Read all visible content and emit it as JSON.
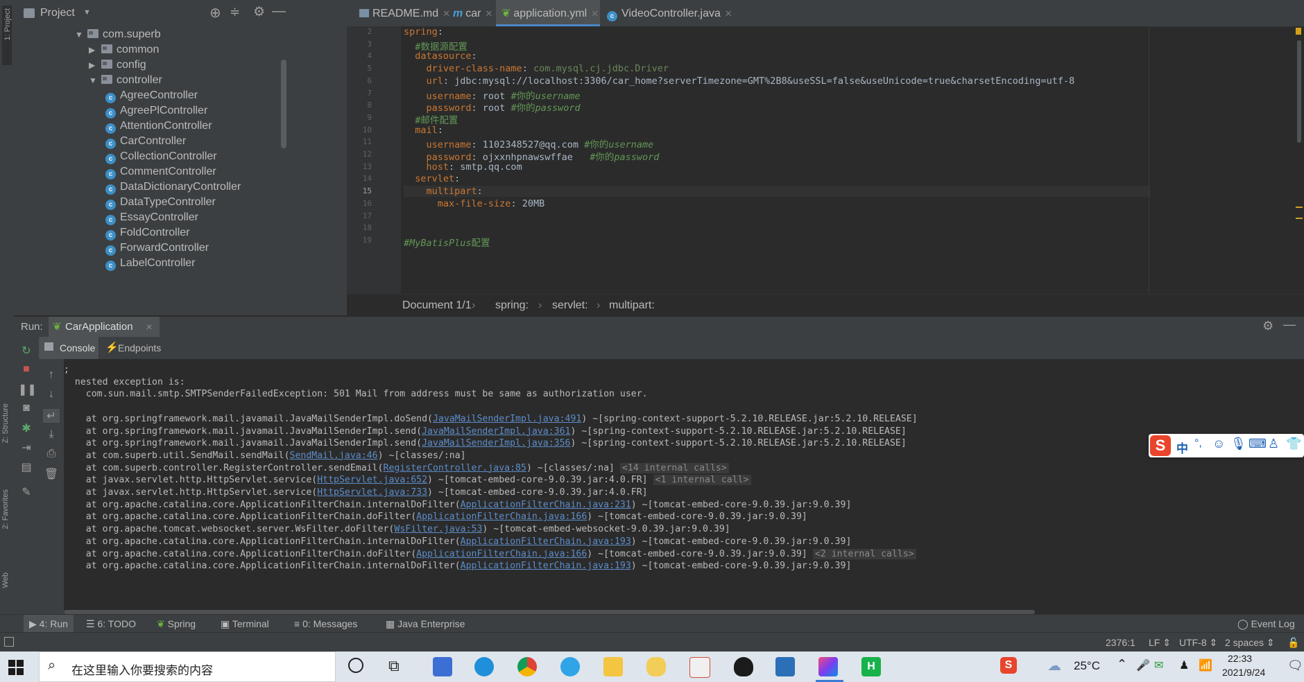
{
  "left_strip": {
    "project_label": "1: Project",
    "structure_label": "Z: Structure",
    "favorites_label": "2: Favorites",
    "web_label": "Web"
  },
  "project": {
    "title": "Project",
    "tree": [
      {
        "label": "com.superb",
        "kind": "package",
        "expanded": true,
        "level": 0
      },
      {
        "label": "common",
        "kind": "package",
        "expanded": false,
        "level": 1
      },
      {
        "label": "config",
        "kind": "package",
        "expanded": false,
        "level": 1
      },
      {
        "label": "controller",
        "kind": "package",
        "expanded": true,
        "level": 1
      },
      {
        "label": "AgreeController",
        "kind": "class",
        "level": 2
      },
      {
        "label": "AgreePlController",
        "kind": "class",
        "level": 2
      },
      {
        "label": "AttentionController",
        "kind": "class",
        "level": 2
      },
      {
        "label": "CarController",
        "kind": "class",
        "level": 2
      },
      {
        "label": "CollectionController",
        "kind": "class",
        "level": 2
      },
      {
        "label": "CommentController",
        "kind": "class",
        "level": 2
      },
      {
        "label": "DataDictionaryController",
        "kind": "class",
        "level": 2
      },
      {
        "label": "DataTypeController",
        "kind": "class",
        "level": 2
      },
      {
        "label": "EssayController",
        "kind": "class",
        "level": 2
      },
      {
        "label": "FoldController",
        "kind": "class",
        "level": 2
      },
      {
        "label": "ForwardController",
        "kind": "class",
        "level": 2
      },
      {
        "label": "LabelController",
        "kind": "class",
        "level": 2
      }
    ]
  },
  "tabs": [
    {
      "label": "README.md",
      "icon": "markdown-icon",
      "active": false
    },
    {
      "label": "car",
      "icon": "m-icon",
      "active": false
    },
    {
      "label": "application.yml",
      "icon": "spring-leaf-icon",
      "active": true
    },
    {
      "label": "VideoController.java",
      "icon": "class-icon",
      "active": false
    }
  ],
  "editor": {
    "lines": [
      {
        "n": "2",
        "parts": [
          {
            "t": "spring",
            "c": "k"
          },
          {
            "t": ":",
            "c": "v"
          }
        ]
      },
      {
        "n": "3",
        "parts": [
          {
            "t": "  #数据源配置",
            "c": "c"
          }
        ]
      },
      {
        "n": "4",
        "parts": [
          {
            "t": "  datasource",
            "c": "k"
          },
          {
            "t": ":",
            "c": "v"
          }
        ]
      },
      {
        "n": "5",
        "parts": [
          {
            "t": "    driver-class-name",
            "c": "k"
          },
          {
            "t": ": ",
            "c": "v"
          },
          {
            "t": "com.mysql.cj.jdbc.Driver",
            "c": "s"
          }
        ]
      },
      {
        "n": "6",
        "parts": [
          {
            "t": "    url",
            "c": "k"
          },
          {
            "t": ": jdbc:mysql://localhost:3306/car_home?serverTimezone=GMT%2B8&useSSL=false&useUnicode=true&charsetEncoding=utf-8",
            "c": "v"
          }
        ]
      },
      {
        "n": "7",
        "parts": [
          {
            "t": "    username",
            "c": "k"
          },
          {
            "t": ": root ",
            "c": "v"
          },
          {
            "t": "#你的",
            "c": "c"
          },
          {
            "t": "username",
            "c": "ci"
          }
        ]
      },
      {
        "n": "8",
        "parts": [
          {
            "t": "    password",
            "c": "k"
          },
          {
            "t": ": root ",
            "c": "v"
          },
          {
            "t": "#你的",
            "c": "c"
          },
          {
            "t": "password",
            "c": "ci"
          }
        ]
      },
      {
        "n": "9",
        "parts": [
          {
            "t": "  #邮件配置",
            "c": "c"
          }
        ]
      },
      {
        "n": "10",
        "parts": [
          {
            "t": "  mail",
            "c": "k"
          },
          {
            "t": ":",
            "c": "v"
          }
        ]
      },
      {
        "n": "11",
        "parts": [
          {
            "t": "    username",
            "c": "k"
          },
          {
            "t": ": 1102348527@qq.com ",
            "c": "v"
          },
          {
            "t": "#你的",
            "c": "c"
          },
          {
            "t": "username",
            "c": "ci"
          }
        ]
      },
      {
        "n": "12",
        "parts": [
          {
            "t": "    password",
            "c": "k"
          },
          {
            "t": ": ojxxnhpnawswffae   ",
            "c": "v"
          },
          {
            "t": "#你的",
            "c": "c"
          },
          {
            "t": "password",
            "c": "ci"
          }
        ]
      },
      {
        "n": "13",
        "parts": [
          {
            "t": "    host",
            "c": "k"
          },
          {
            "t": ": smtp.qq.com",
            "c": "v"
          }
        ]
      },
      {
        "n": "14",
        "parts": [
          {
            "t": "  servlet",
            "c": "k"
          },
          {
            "t": ":",
            "c": "v"
          }
        ]
      },
      {
        "n": "15",
        "parts": [
          {
            "t": "    multipart",
            "c": "k"
          },
          {
            "t": ":",
            "c": "v"
          }
        ]
      },
      {
        "n": "16",
        "parts": [
          {
            "t": "      max-file-size",
            "c": "k"
          },
          {
            "t": ": 20MB",
            "c": "v"
          }
        ]
      },
      {
        "n": "17",
        "parts": []
      },
      {
        "n": "18",
        "parts": []
      },
      {
        "n": "19",
        "parts": [
          {
            "t": "#MyBatisPlus",
            "c": "ci"
          },
          {
            "t": "配置",
            "c": "c"
          }
        ]
      }
    ]
  },
  "breadcrumb": [
    "Document 1/1",
    "spring:",
    "servlet:",
    "multipart:"
  ],
  "run": {
    "label": "Run:",
    "config": "CarApplication",
    "console_tab": "Console",
    "endpoints_tab": "Endpoints"
  },
  "console": {
    "lines": [
      {
        "parts": [
          {
            "t": ";"
          }
        ]
      },
      {
        "parts": [
          {
            "t": "  nested exception is:"
          }
        ]
      },
      {
        "parts": [
          {
            "t": "    com.sun.mail.smtp.SMTPSenderFailedException: 501 Mail from address must be same as authorization user."
          }
        ]
      },
      {
        "parts": [
          {
            "t": ""
          }
        ]
      },
      {
        "parts": [
          {
            "t": "    at org.springframework.mail.javamail.JavaMailSenderImpl.doSend("
          },
          {
            "t": "JavaMailSenderImpl.java:491",
            "k": "link"
          },
          {
            "t": ") ~[spring-context-support-5.2.10.RELEASE.jar:5.2.10.RELEASE]"
          }
        ]
      },
      {
        "parts": [
          {
            "t": "    at org.springframework.mail.javamail.JavaMailSenderImpl.send("
          },
          {
            "t": "JavaMailSenderImpl.java:361",
            "k": "link"
          },
          {
            "t": ") ~[spring-context-support-5.2.10.RELEASE.jar:5.2.10.RELEASE]"
          }
        ]
      },
      {
        "parts": [
          {
            "t": "    at org.springframework.mail.javamail.JavaMailSenderImpl.send("
          },
          {
            "t": "JavaMailSenderImpl.java:356",
            "k": "link"
          },
          {
            "t": ") ~[spring-context-support-5.2.10.RELEASE.jar:5.2.10.RELEASE]"
          }
        ]
      },
      {
        "parts": [
          {
            "t": "    at com.superb.util.SendMail.sendMail("
          },
          {
            "t": "SendMail.java:46",
            "k": "link"
          },
          {
            "t": ") ~[classes/:na]"
          }
        ]
      },
      {
        "parts": [
          {
            "t": "    at com.superb.controller.RegisterController.sendEmail("
          },
          {
            "t": "RegisterController.java:85",
            "k": "link"
          },
          {
            "t": ") ~[classes/:na] "
          },
          {
            "t": "<14 internal calls>",
            "k": "dim"
          }
        ]
      },
      {
        "parts": [
          {
            "t": "    at javax.servlet.http.HttpServlet.service("
          },
          {
            "t": "HttpServlet.java:652",
            "k": "link"
          },
          {
            "t": ") ~[tomcat-embed-core-9.0.39.jar:4.0.FR] "
          },
          {
            "t": "<1 internal call>",
            "k": "dim"
          }
        ]
      },
      {
        "parts": [
          {
            "t": "    at javax.servlet.http.HttpServlet.service("
          },
          {
            "t": "HttpServlet.java:733",
            "k": "link"
          },
          {
            "t": ") ~[tomcat-embed-core-9.0.39.jar:4.0.FR]"
          }
        ]
      },
      {
        "parts": [
          {
            "t": "    at org.apache.catalina.core.ApplicationFilterChain.internalDoFilter("
          },
          {
            "t": "ApplicationFilterChain.java:231",
            "k": "link"
          },
          {
            "t": ") ~[tomcat-embed-core-9.0.39.jar:9.0.39]"
          }
        ]
      },
      {
        "parts": [
          {
            "t": "    at org.apache.catalina.core.ApplicationFilterChain.doFilter("
          },
          {
            "t": "ApplicationFilterChain.java:166",
            "k": "link"
          },
          {
            "t": ") ~[tomcat-embed-core-9.0.39.jar:9.0.39]"
          }
        ]
      },
      {
        "parts": [
          {
            "t": "    at org.apache.tomcat.websocket.server.WsFilter.doFilter("
          },
          {
            "t": "WsFilter.java:53",
            "k": "link"
          },
          {
            "t": ") ~[tomcat-embed-websocket-9.0.39.jar:9.0.39]"
          }
        ]
      },
      {
        "parts": [
          {
            "t": "    at org.apache.catalina.core.ApplicationFilterChain.internalDoFilter("
          },
          {
            "t": "ApplicationFilterChain.java:193",
            "k": "link"
          },
          {
            "t": ") ~[tomcat-embed-core-9.0.39.jar:9.0.39]"
          }
        ]
      },
      {
        "parts": [
          {
            "t": "    at org.apache.catalina.core.ApplicationFilterChain.doFilter("
          },
          {
            "t": "ApplicationFilterChain.java:166",
            "k": "link"
          },
          {
            "t": ") ~[tomcat-embed-core-9.0.39.jar:9.0.39] "
          },
          {
            "t": "<2 internal calls>",
            "k": "dim"
          }
        ]
      },
      {
        "parts": [
          {
            "t": "    at org.apache.catalina.core.ApplicationFilterChain.internalDoFilter("
          },
          {
            "t": "ApplicationFilterChain.java:193",
            "k": "link"
          },
          {
            "t": ") ~[tomcat-embed-core-9.0.39.jar:9.0.39]"
          }
        ]
      }
    ]
  },
  "bottom_tabs": [
    {
      "label": "4: Run",
      "icon": "play-icon"
    },
    {
      "label": "6: TODO",
      "icon": "list-icon"
    },
    {
      "label": "Spring",
      "icon": "spring-leaf-icon"
    },
    {
      "label": "Terminal",
      "icon": "terminal-icon"
    },
    {
      "label": "0: Messages",
      "icon": "messages-icon"
    },
    {
      "label": "Java Enterprise",
      "icon": "java-enterprise-icon"
    }
  ],
  "event_log": "Event Log",
  "status": {
    "position": "2376:1",
    "line_sep": "LF",
    "encoding": "UTF-8",
    "indent": "2 spaces"
  },
  "taskbar": {
    "search_placeholder": "在这里输入你要搜索的内容",
    "temperature": "25°C",
    "time": "22:33",
    "date": "2021/9/24"
  },
  "ime": {
    "mode": "中",
    "punct": "°,"
  }
}
